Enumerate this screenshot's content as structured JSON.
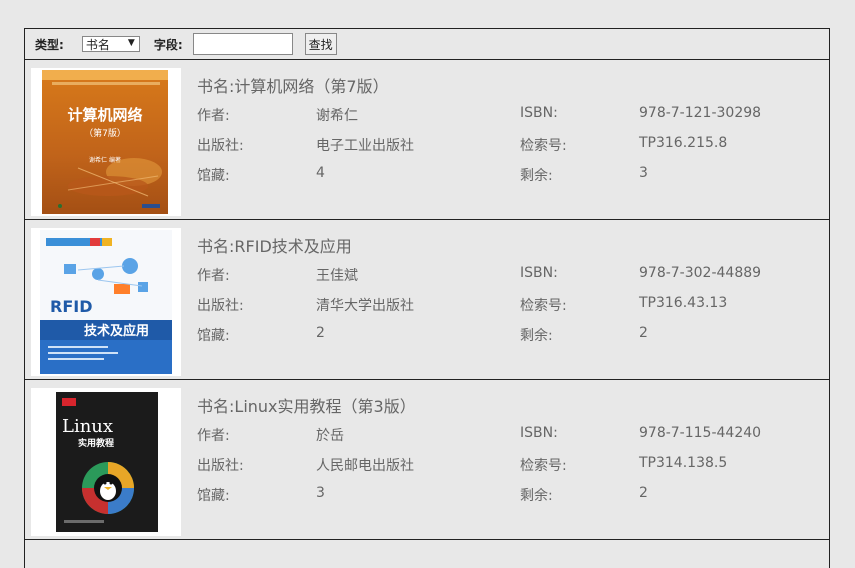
{
  "search": {
    "type_label": "类型:",
    "type_value": "书名",
    "field_label": "字段:",
    "field_value": "",
    "button": "查找"
  },
  "labels": {
    "title": "书名:",
    "author": "作者:",
    "isbn": "ISBN:",
    "publisher": "出版社:",
    "call_no": "检索号:",
    "holdings": "馆藏:",
    "remaining": "剩余:"
  },
  "books": [
    {
      "title": "计算机网络（第7版）",
      "author": "谢希仁",
      "isbn": "978-7-121-30298",
      "publisher": "电子工业出版社",
      "call_no": "TP316.215.8",
      "holdings": "4",
      "remaining": "3",
      "cover_title": "计算机网络",
      "cover_edition": "（第7版）",
      "cover_author": "谢希仁 编著"
    },
    {
      "title": "RFID技术及应用",
      "author": "王佳斌",
      "isbn": "978-7-302-44889",
      "publisher": "清华大学出版社",
      "call_no": "TP316.43.13",
      "holdings": "2",
      "remaining": "2",
      "cover_title_line1": "RFID",
      "cover_title_line2": "技术及应用"
    },
    {
      "title": "Linux实用教程（第3版）",
      "author": "於岳",
      "isbn": "978-7-115-44240",
      "publisher": "人民邮电出版社",
      "call_no": "TP314.138.5",
      "holdings": "3",
      "remaining": "2",
      "cover_title_line1": "Linux",
      "cover_title_line2": "实用教程"
    }
  ]
}
